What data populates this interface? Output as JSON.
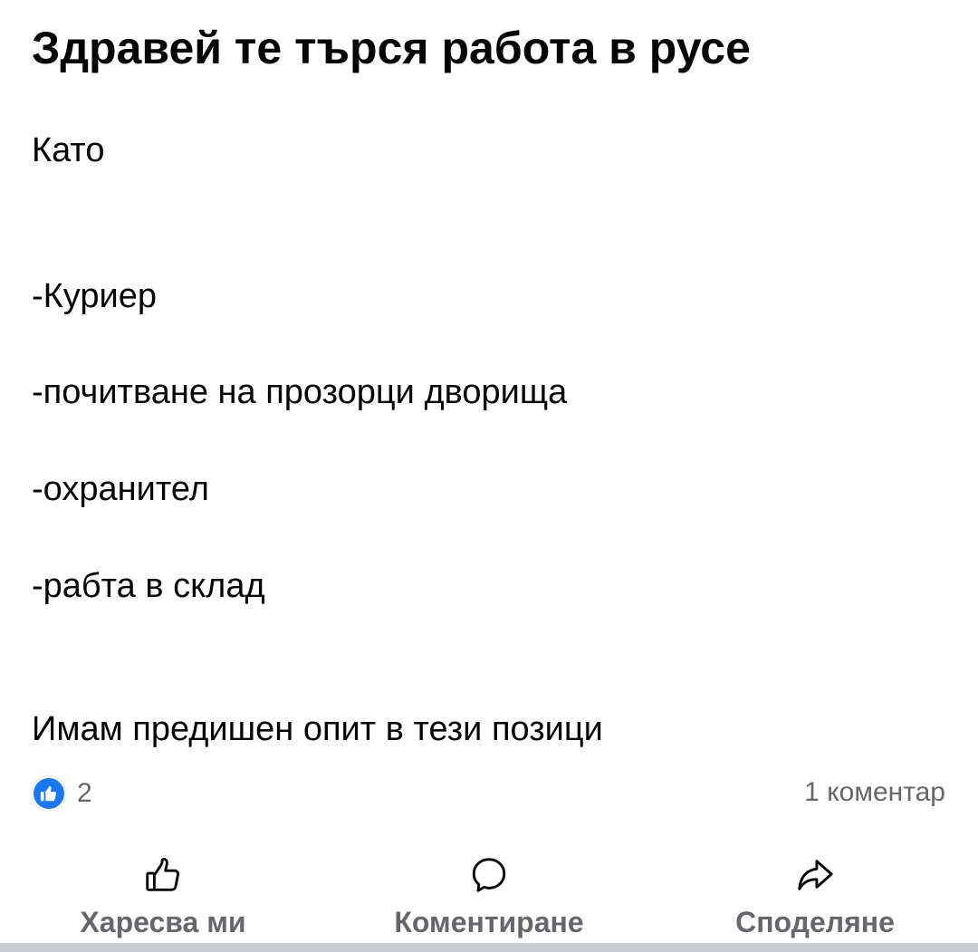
{
  "post": {
    "title": "Здравей те търся работа в русе",
    "intro": "Като",
    "items": [
      "-Куриер",
      "-почитване на прозорци дворища",
      "-охранител",
      "-рабта в склад"
    ],
    "closing": "Имам предишен опит в тези позици"
  },
  "stats": {
    "like_count": "2",
    "comment_count": "1 коментар"
  },
  "actions": {
    "like_label": "Харесва ми",
    "comment_label": "Коментиране",
    "share_label": "Споделяне"
  },
  "icons": {
    "like_badge": "thumbs-up-icon",
    "like": "thumbs-up-outline-icon",
    "comment": "speech-bubble-icon",
    "share": "share-arrow-icon"
  },
  "colors": {
    "brand_blue": "#1877f2",
    "secondary_text": "#65676b",
    "primary_text": "#050505",
    "divider": "#c9ccd1"
  }
}
